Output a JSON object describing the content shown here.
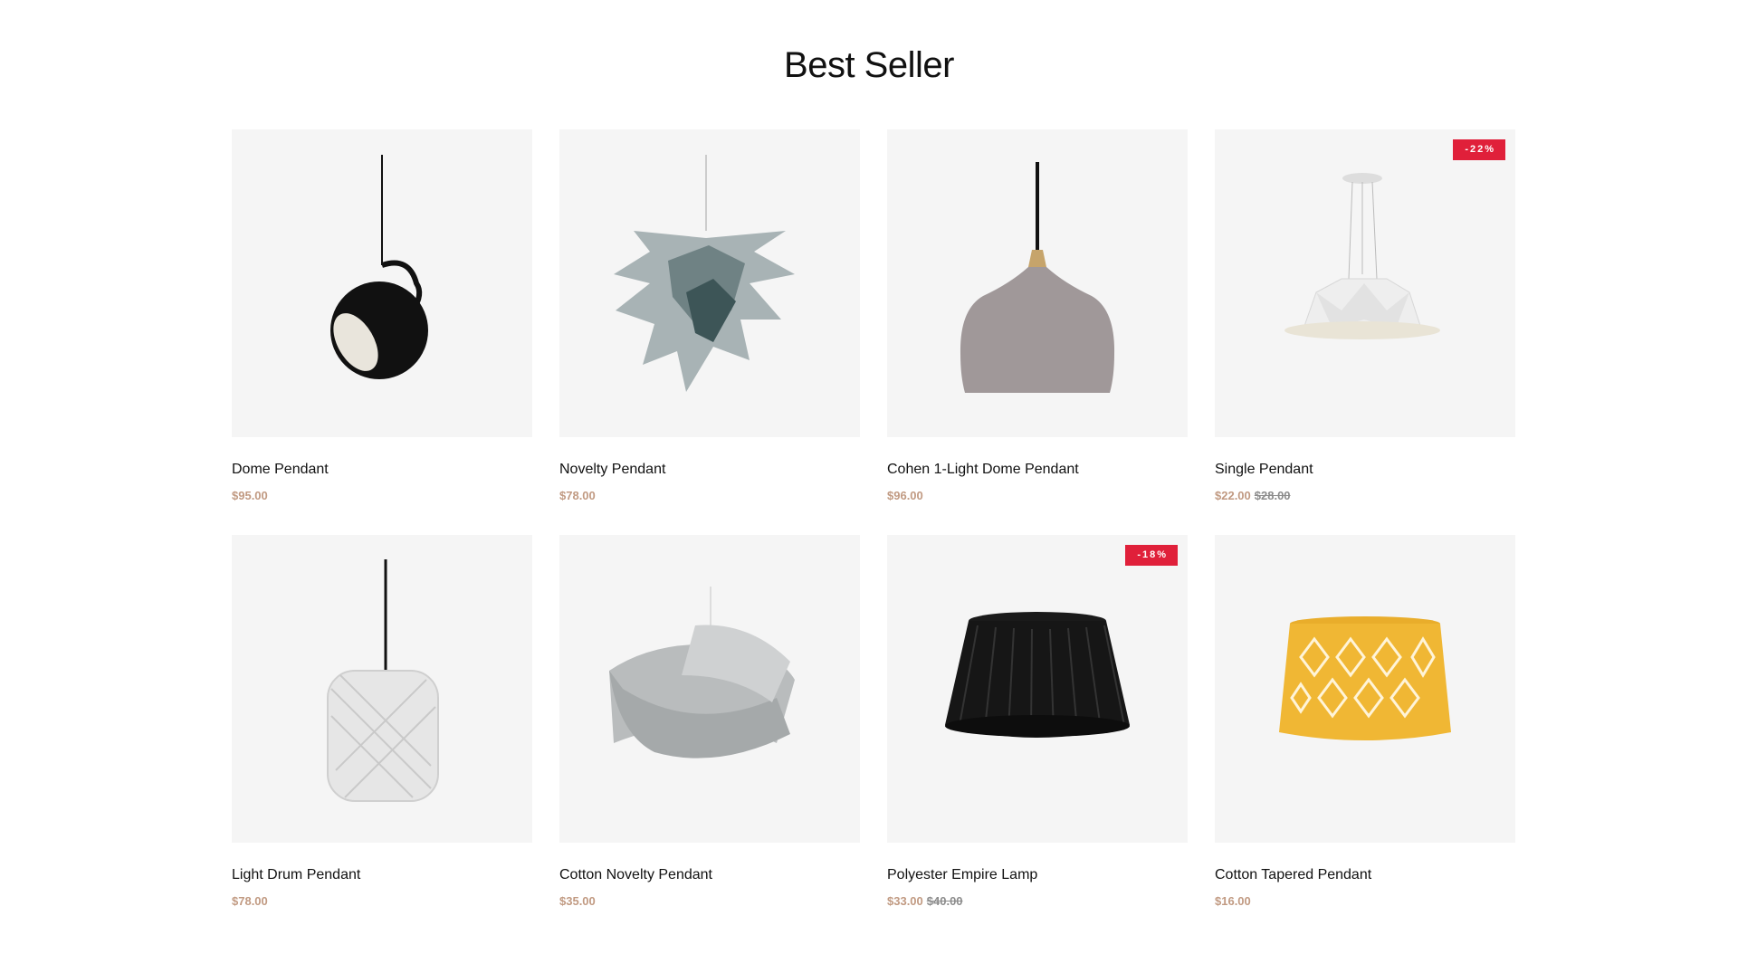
{
  "section": {
    "title": "Best Seller"
  },
  "products": [
    {
      "name": "Dome Pendant",
      "price": "$95.00",
      "old_price": "",
      "badge": "",
      "icon": "dome-pendant-lamp-icon"
    },
    {
      "name": "Novelty Pendant",
      "price": "$78.00",
      "old_price": "",
      "badge": "",
      "icon": "pinecone-pendant-lamp-icon"
    },
    {
      "name": "Cohen 1-Light Dome Pendant",
      "price": "$96.00",
      "old_price": "",
      "badge": "",
      "icon": "bell-pendant-lamp-icon"
    },
    {
      "name": "Single Pendant",
      "price": "$22.00",
      "old_price": "$28.00",
      "badge": "-22%",
      "icon": "geometric-pendant-lamp-icon"
    },
    {
      "name": "Light Drum Pendant",
      "price": "$78.00",
      "old_price": "",
      "badge": "",
      "icon": "drum-pendant-lamp-icon"
    },
    {
      "name": "Cotton Novelty Pendant",
      "price": "$35.00",
      "old_price": "",
      "badge": "",
      "icon": "ribbon-pendant-lamp-icon"
    },
    {
      "name": "Polyester Empire Lamp",
      "price": "$33.00",
      "old_price": "$40.00",
      "badge": "-18%",
      "icon": "pleated-lampshade-icon"
    },
    {
      "name": "Cotton Tapered Pendant",
      "price": "$16.00",
      "old_price": "",
      "badge": "",
      "icon": "yellow-tapered-lampshade-icon"
    }
  ],
  "colors": {
    "accent_price": "#c19a82",
    "badge_bg": "#e0203a",
    "card_bg": "#f5f5f5"
  }
}
